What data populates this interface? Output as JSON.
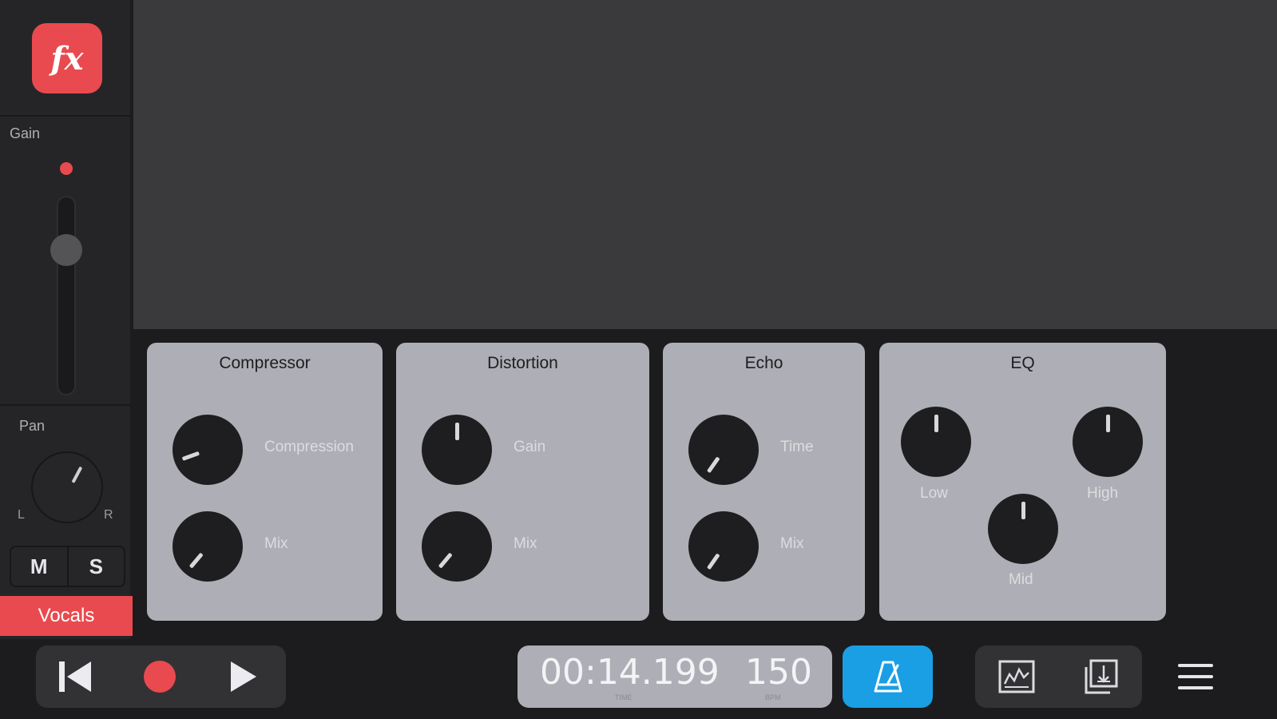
{
  "strip": {
    "fx_label": "fx",
    "gain_label": "Gain",
    "pan_label": "Pan",
    "pan_left": "L",
    "pan_right": "R",
    "mute_label": "M",
    "solo_label": "S",
    "track_name": "Vocals",
    "accent_color": "#e94a4f"
  },
  "effects": {
    "compressor": {
      "title": "Compressor",
      "knob1_label": "Compression",
      "knob2_label": "Mix"
    },
    "distortion": {
      "title": "Distortion",
      "knob1_label": "Gain",
      "knob2_label": "Mix"
    },
    "echo": {
      "title": "Echo",
      "knob1_label": "Time",
      "knob2_label": "Mix"
    },
    "eq": {
      "title": "EQ",
      "low_label": "Low",
      "mid_label": "Mid",
      "high_label": "High"
    }
  },
  "transport": {
    "time_value": "00:14.199",
    "time_caption": "TIME",
    "bpm_value": "150",
    "bpm_caption": "BPM",
    "metronome_color": "#1a9fe4"
  },
  "icons": {
    "skip_back": "skip-to-start-icon",
    "record": "record-icon",
    "play": "play-icon",
    "metronome": "metronome-icon",
    "mixer": "mixer-view-icon",
    "export": "export-icon",
    "menu": "hamburger-menu-icon"
  }
}
